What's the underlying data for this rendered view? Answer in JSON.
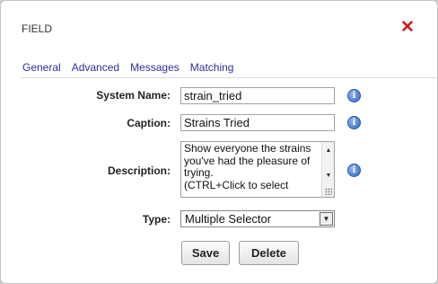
{
  "dialog": {
    "title": "FIELD",
    "close_icon": "close-x",
    "colors": {
      "close": "#d11a1a",
      "tab_link": "#2f2f9c",
      "info_icon": "#2f67c2"
    }
  },
  "tabs": [
    {
      "label": "General"
    },
    {
      "label": "Advanced"
    },
    {
      "label": "Messages"
    },
    {
      "label": "Matching"
    }
  ],
  "form": {
    "system_name": {
      "label": "System Name:",
      "value": "strain_tried",
      "info_icon": "info-icon"
    },
    "caption": {
      "label": "Caption:",
      "value": "Strains Tried",
      "info_icon": "info-icon"
    },
    "description": {
      "label": "Description:",
      "lines": [
        "Show everyone the strains",
        "you've had the pleasure of",
        "trying.",
        "(CTRL+Click to select"
      ],
      "info_icon": "info-icon"
    },
    "type": {
      "label": "Type:",
      "value": "Multiple Selector"
    }
  },
  "buttons": {
    "save": "Save",
    "delete": "Delete"
  }
}
